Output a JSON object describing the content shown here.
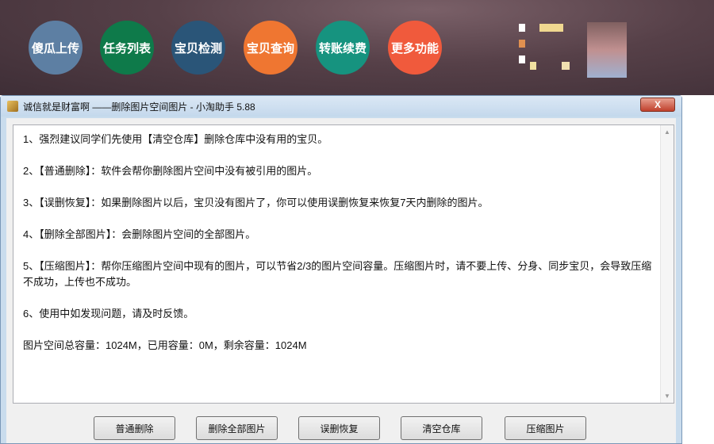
{
  "toolbar": {
    "buttons": [
      {
        "label": "傻瓜上传",
        "color": "#5d7fa3"
      },
      {
        "label": "任务列表",
        "color": "#0e7a4a"
      },
      {
        "label": "宝贝检测",
        "color": "#2a5578"
      },
      {
        "label": "宝贝查询",
        "color": "#ef7631"
      },
      {
        "label": "转账续费",
        "color": "#16937f"
      },
      {
        "label": "更多功能",
        "color": "#f05a3c"
      }
    ]
  },
  "window": {
    "title": "诚信就是财富啊 ——删除图片空间图片 - 小淘助手 5.88",
    "close_label": "X"
  },
  "content": {
    "lines": [
      "1、强烈建议同学们先使用【清空仓库】删除仓库中没有用的宝贝。",
      "2、【普通删除】：软件会帮你删除图片空间中没有被引用的图片。",
      "3、【误删恢复】：如果删除图片以后，宝贝没有图片了，你可以使用误删恢复来恢复7天内删除的图片。",
      "4、【删除全部图片】：会删除图片空间的全部图片。",
      "5、【压缩图片】：帮你压缩图片空间中现有的图片，可以节省2/3的图片空间容量。压缩图片时，请不要上传、分身、同步宝贝，会导致压缩不成功，上传也不成功。",
      "6、使用中如发现问题，请及时反馈。",
      "图片空间总容量：1024M，已用容量：0M，剩余容量：1024M"
    ]
  },
  "actions": [
    "普通删除",
    "删除全部图片",
    "误删恢复",
    "清空仓库",
    "压缩图片"
  ]
}
